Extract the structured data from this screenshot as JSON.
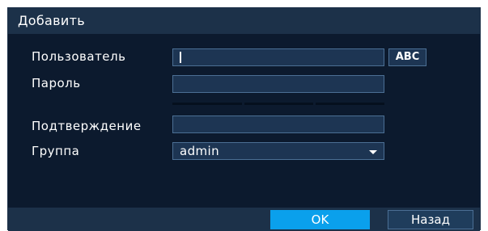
{
  "dialog": {
    "title": "Добавить"
  },
  "form": {
    "user_label": "Пользователь",
    "user_value": "",
    "keyboard_button": "ABC",
    "password_label": "Пароль",
    "password_value": "",
    "confirm_label": "Подтверждение",
    "confirm_value": "",
    "group_label": "Группа",
    "group_selected": "admin"
  },
  "footer": {
    "ok_label": "OK",
    "back_label": "Назад"
  },
  "colors": {
    "dialog_bg": "#0c1a2e",
    "titlebar_bg": "#1c3149",
    "field_bg": "#1d3553",
    "field_border": "#4b6f94",
    "accent": "#0aa0ec"
  }
}
